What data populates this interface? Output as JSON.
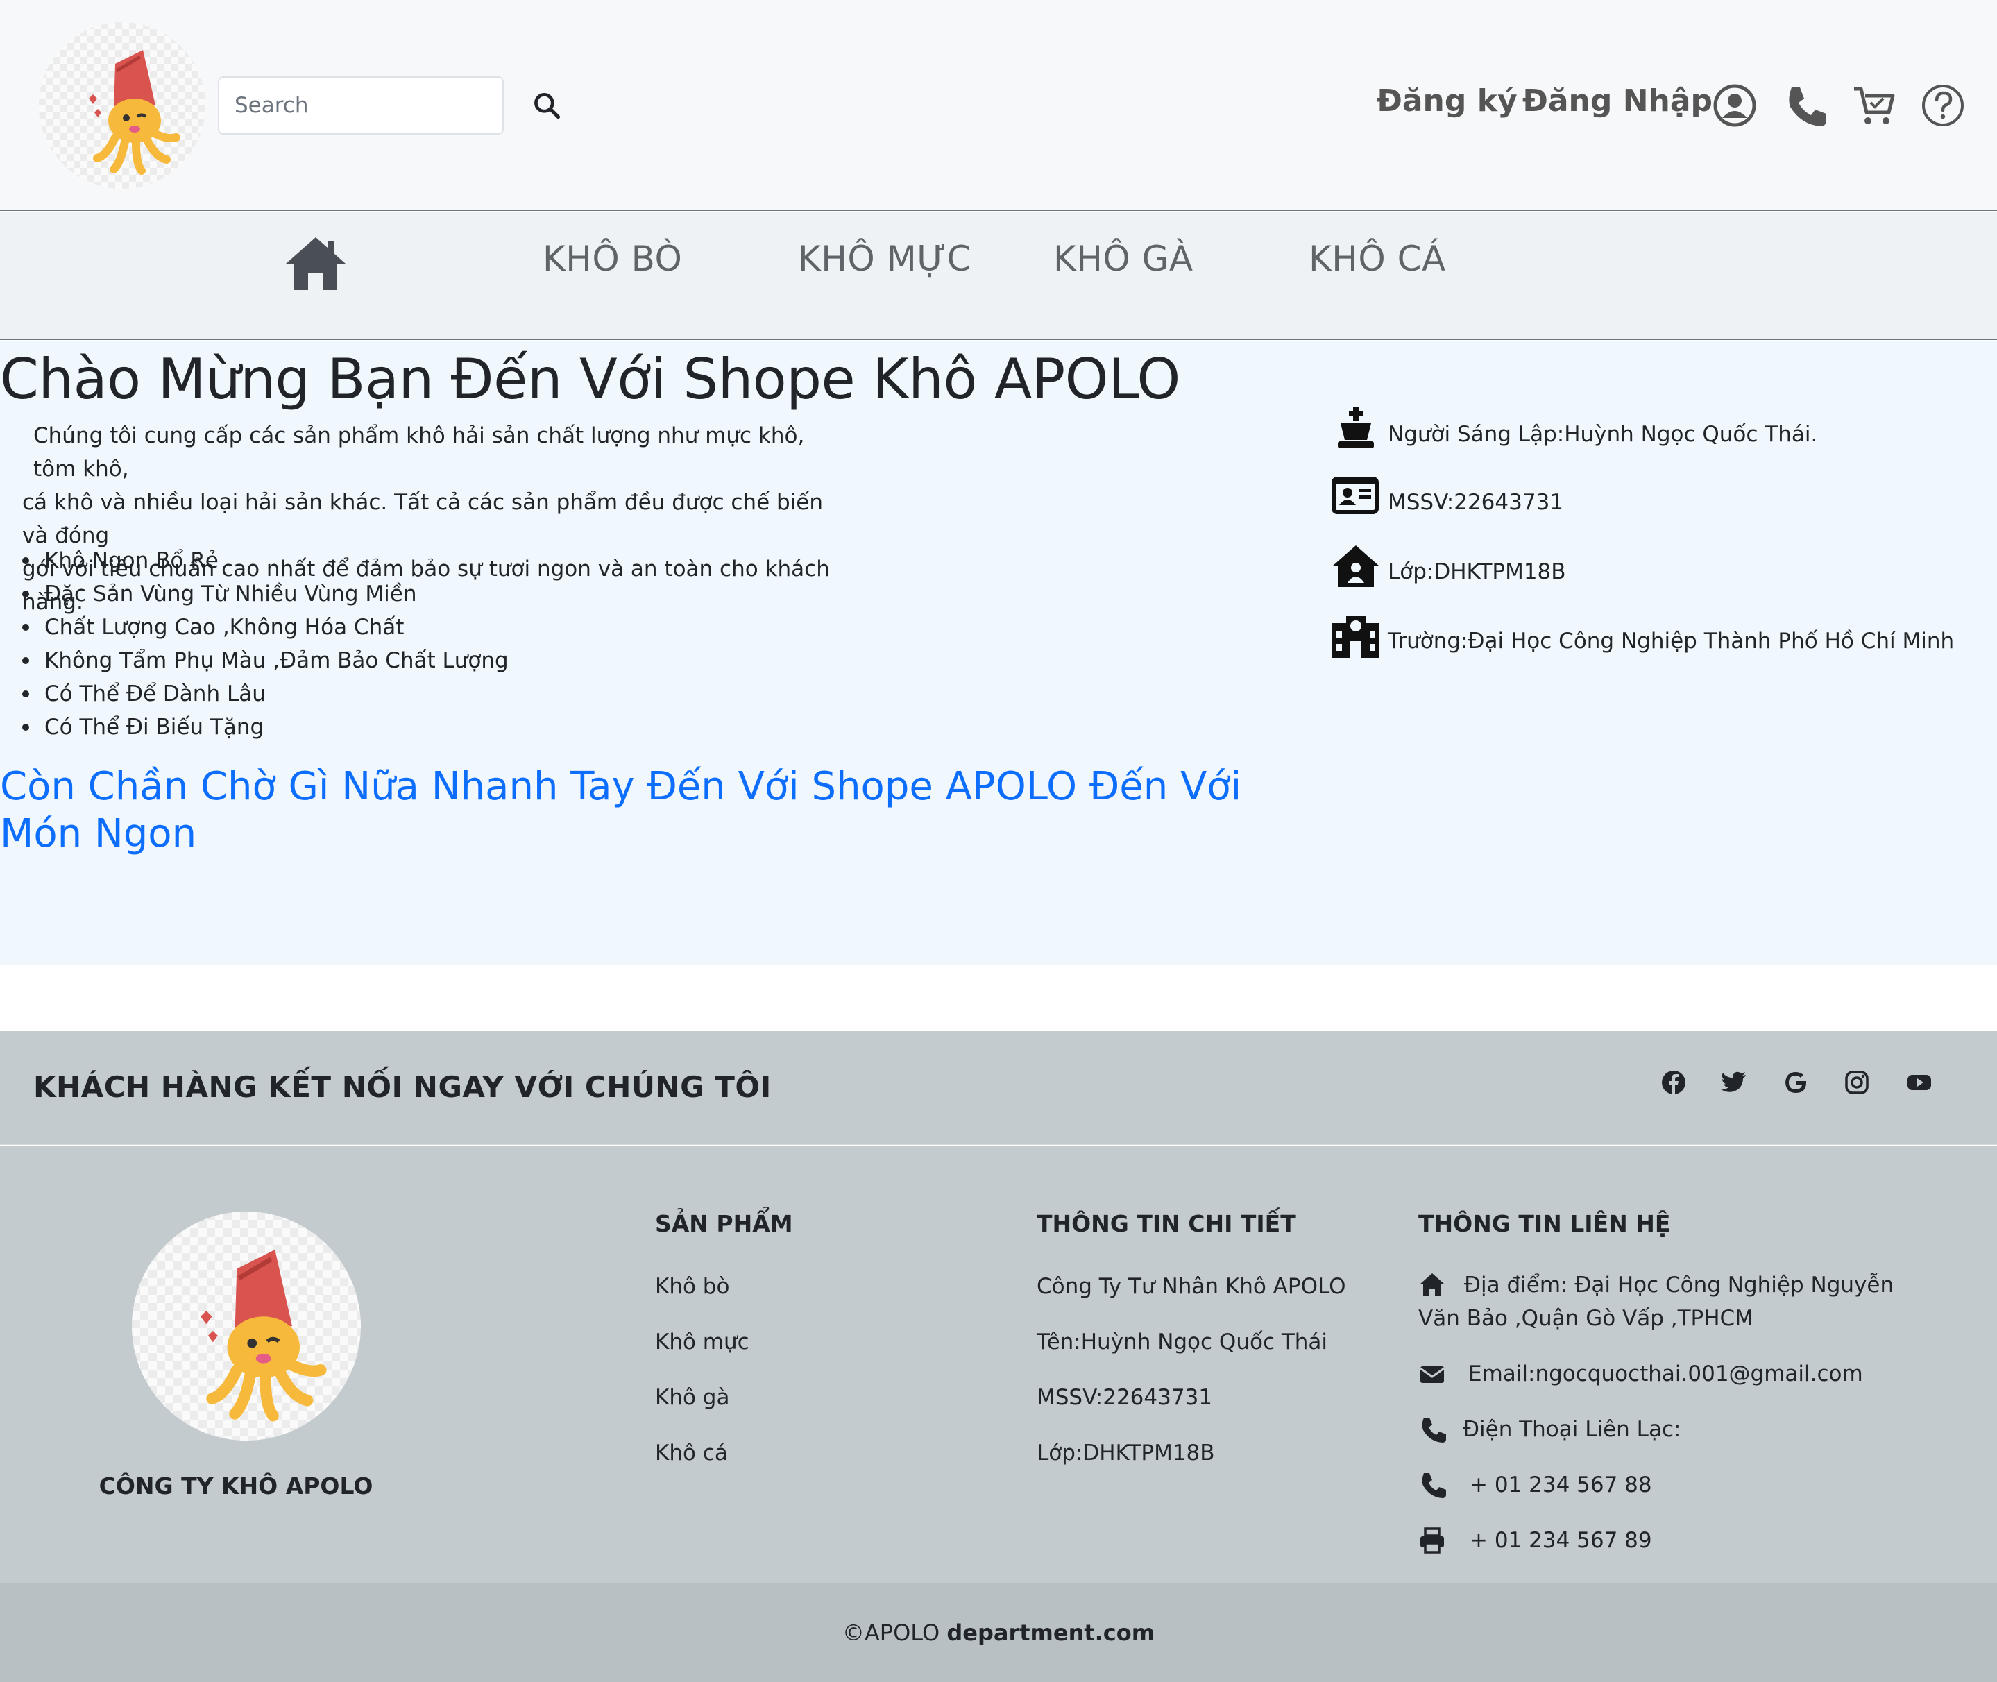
{
  "header": {
    "search_placeholder": "Search",
    "register_label": "Đăng ký",
    "login_label": "Đăng Nhập"
  },
  "nav": {
    "items": [
      "KHÔ BÒ",
      "KHÔ MỰC",
      "KHÔ GÀ",
      "KHÔ CÁ"
    ]
  },
  "main": {
    "title": "Chào Mừng Bạn Đến Với Shope Khô APOLO",
    "intro_lines": [
      "Chúng tôi cung cấp các sản phẩm khô hải sản chất lượng như mực khô, tôm khô,",
      "cá khô và nhiều loại hải sản khác. Tất cả các sản phẩm đều được chế biến và đóng",
      "gói với tiêu chuẩn cao nhất để đảm bảo sự tươi ngon và an toàn cho khách hàng."
    ],
    "features": [
      "Khô Ngon Bổ Rẻ",
      "Đặc Sản Vùng Từ Nhiều Vùng Miền",
      "Chất Lượng Cao ,Không Hóa Chất",
      "Không Tẩm Phụ Màu ,Đảm Bảo Chất Lượng",
      "Có Thể Để Dành Lâu",
      "Có Thể Đi Biếu Tặng"
    ],
    "cta": "Còn Chần Chờ Gì Nữa Nhanh Tay Đến Với Shope APOLO Đến Với Món Ngon",
    "info": {
      "founder": "Người Sáng Lập:Huỳnh Ngọc Quốc Thái.",
      "student_id": "MSSV:22643731",
      "class": "Lớp:DHKTPM18B",
      "school": "Trường:Đại Học Công Nghiệp Thành Phố Hồ Chí Minh"
    }
  },
  "footer": {
    "social_title": "KHÁCH HÀNG KẾT NỐI NGAY VỚI CHÚNG TÔI",
    "social_icons": [
      "facebook-icon",
      "twitter-icon",
      "google-icon",
      "instagram-icon",
      "youtube-icon"
    ],
    "company_name": "CÔNG TY KHÔ APOLO",
    "products": {
      "title": "SẢN PHẨM",
      "links": [
        "Khô bò",
        "Khô mực",
        "Khô gà",
        "Khô cá"
      ]
    },
    "details": {
      "title": "THÔNG TIN CHI TIẾT",
      "lines": [
        "Công Ty Tư Nhân Khô APOLO",
        "Tên:Huỳnh Ngọc Quốc Thái",
        "MSSV:22643731",
        "Lớp:DHKTPM18B"
      ]
    },
    "contact": {
      "title": "THÔNG TIN LIÊN HỆ",
      "address_line1": "Địa điểm: Đại Học Công Nghiệp Nguyễn",
      "address_line2": "Văn Bảo ,Quận Gò Vấp ,TPHCM",
      "email": "Email:ngocquocthai.001@gmail.com",
      "phone_label": "Điện Thoại Liên Lạc:",
      "phone": "+ 01 234 567 88",
      "fax": "+ 01 234 567 89"
    },
    "copyright_prefix": "©APOLO",
    "copyright_domain": "department.com"
  },
  "colors": {
    "accent": "#0d6efd",
    "footer_bg": "#c4cbcf",
    "main_bg": "#f0f7fd"
  }
}
